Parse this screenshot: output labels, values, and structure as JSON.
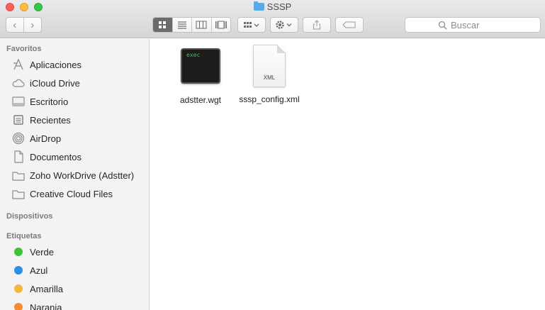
{
  "window": {
    "title": "SSSP"
  },
  "toolbar": {
    "back_glyph": "‹",
    "forward_glyph": "›",
    "search_placeholder": "Buscar"
  },
  "sidebar": {
    "favorites_header": "Favoritos",
    "favorites": [
      {
        "label": "Aplicaciones",
        "icon": "applications-icon"
      },
      {
        "label": "iCloud Drive",
        "icon": "cloud-icon"
      },
      {
        "label": "Escritorio",
        "icon": "desktop-icon"
      },
      {
        "label": "Recientes",
        "icon": "recents-icon"
      },
      {
        "label": "AirDrop",
        "icon": "airdrop-icon"
      },
      {
        "label": "Documentos",
        "icon": "documents-icon"
      },
      {
        "label": "Zoho WorkDrive (Adstter)",
        "icon": "folder-icon"
      },
      {
        "label": "Creative Cloud Files",
        "icon": "folder-icon"
      }
    ],
    "devices_header": "Dispositivos",
    "tags_header": "Etiquetas",
    "tags": [
      {
        "label": "Verde",
        "color": "#44c13a"
      },
      {
        "label": "Azul",
        "color": "#2f8fe0"
      },
      {
        "label": "Amarilla",
        "color": "#f4b63f"
      },
      {
        "label": "Naranja",
        "color": "#f58a2f"
      }
    ]
  },
  "files": [
    {
      "name": "adstter.wgt",
      "type": "exec",
      "badge": "exec"
    },
    {
      "name": "sssp_config.xml",
      "type": "xml",
      "badge": "XML"
    }
  ]
}
